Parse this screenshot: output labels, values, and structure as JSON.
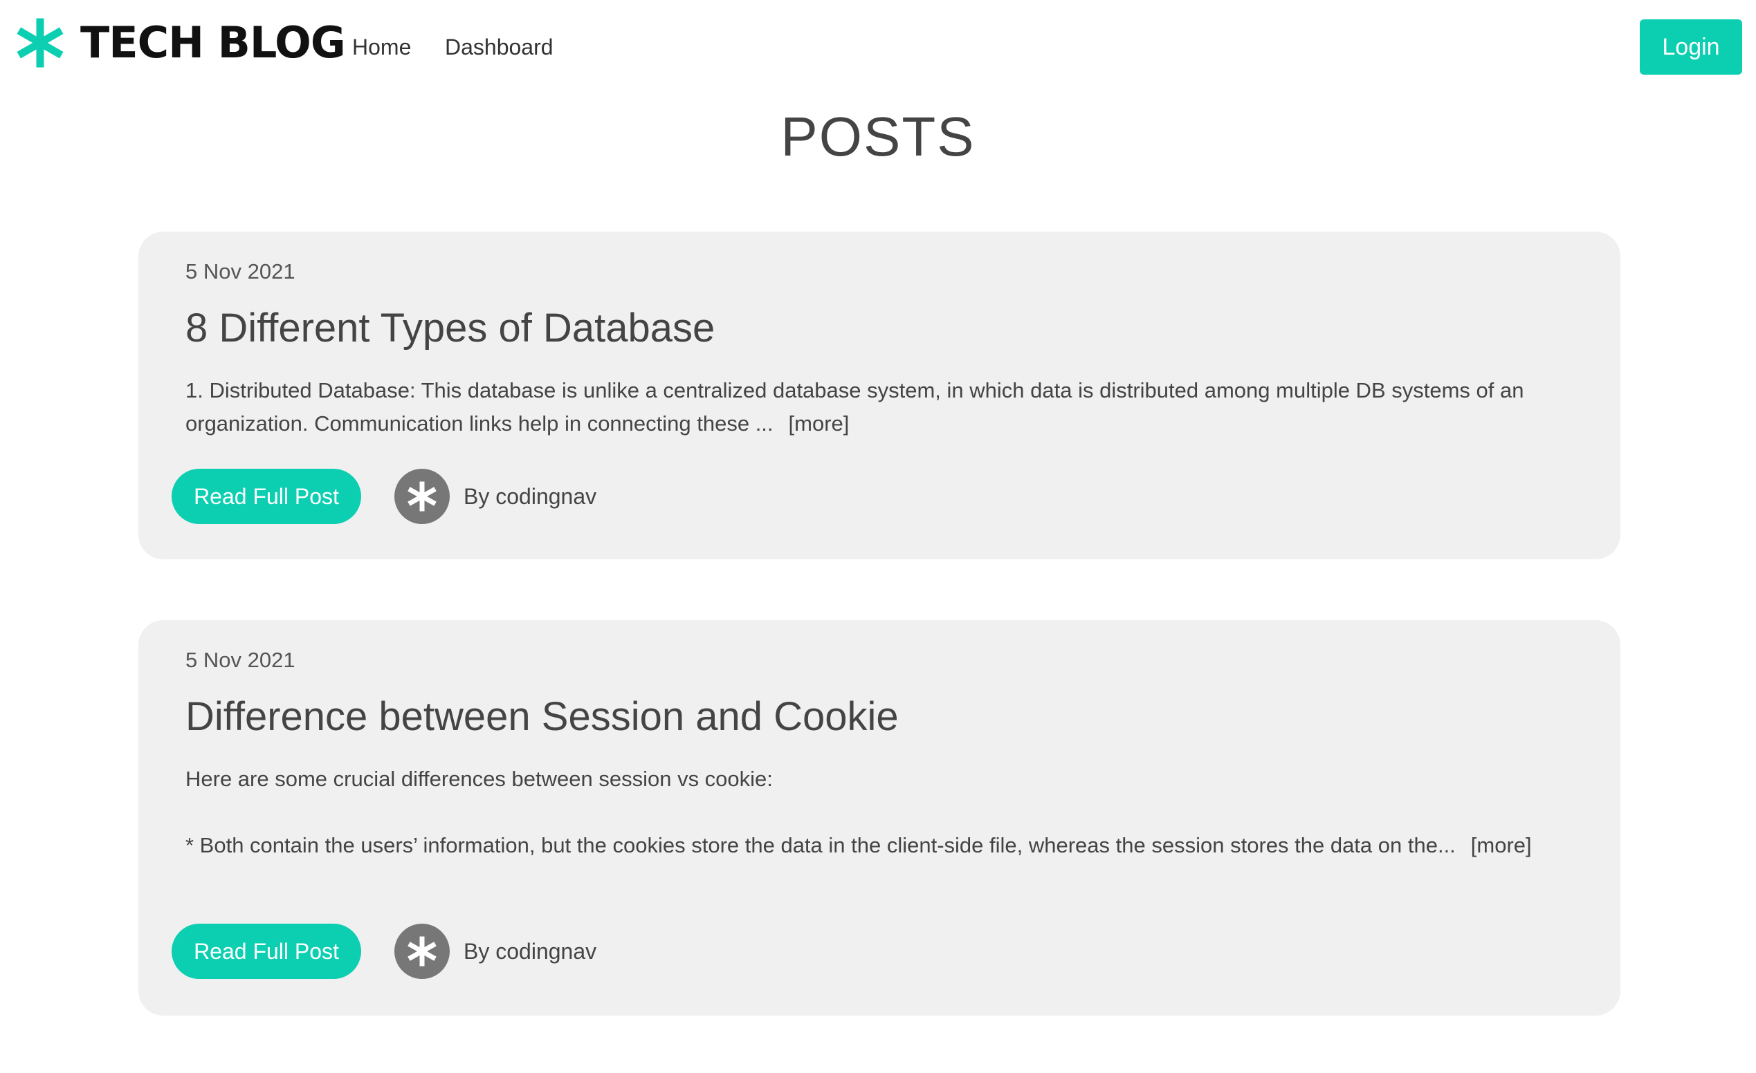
{
  "header": {
    "brand": "TECH BLOG",
    "nav": {
      "home": "Home",
      "dashboard": "Dashboard"
    },
    "login_label": "Login"
  },
  "page": {
    "title": "POSTS"
  },
  "posts": [
    {
      "date": "5 Nov 2021",
      "title": "8 Different Types of Database",
      "excerpt": [
        "1. Distributed Database: This database is unlike a centralized database system, in which data is distributed among multiple DB systems of an organization. Communication links help in connecting these ..."
      ],
      "more_label": "[more]",
      "read_label": "Read Full Post",
      "author": "By codingnav"
    },
    {
      "date": "5 Nov 2021",
      "title": "Difference between Session and Cookie",
      "excerpt": [
        "Here are some crucial differences between session vs cookie:",
        "* Both contain the users’ information, but the cookies store the data in the client-side file, whereas the session stores the data on the..."
      ],
      "more_label": "[more]",
      "read_label": "Read Full Post",
      "author": "By codingnav"
    }
  ],
  "icons": {
    "brand": "asterisk-icon",
    "avatar": "asterisk-avatar-icon"
  },
  "colors": {
    "accent": "#0ccfb1",
    "card_background": "#f0f0f0",
    "avatar_background": "#777777",
    "text": "#444444"
  }
}
